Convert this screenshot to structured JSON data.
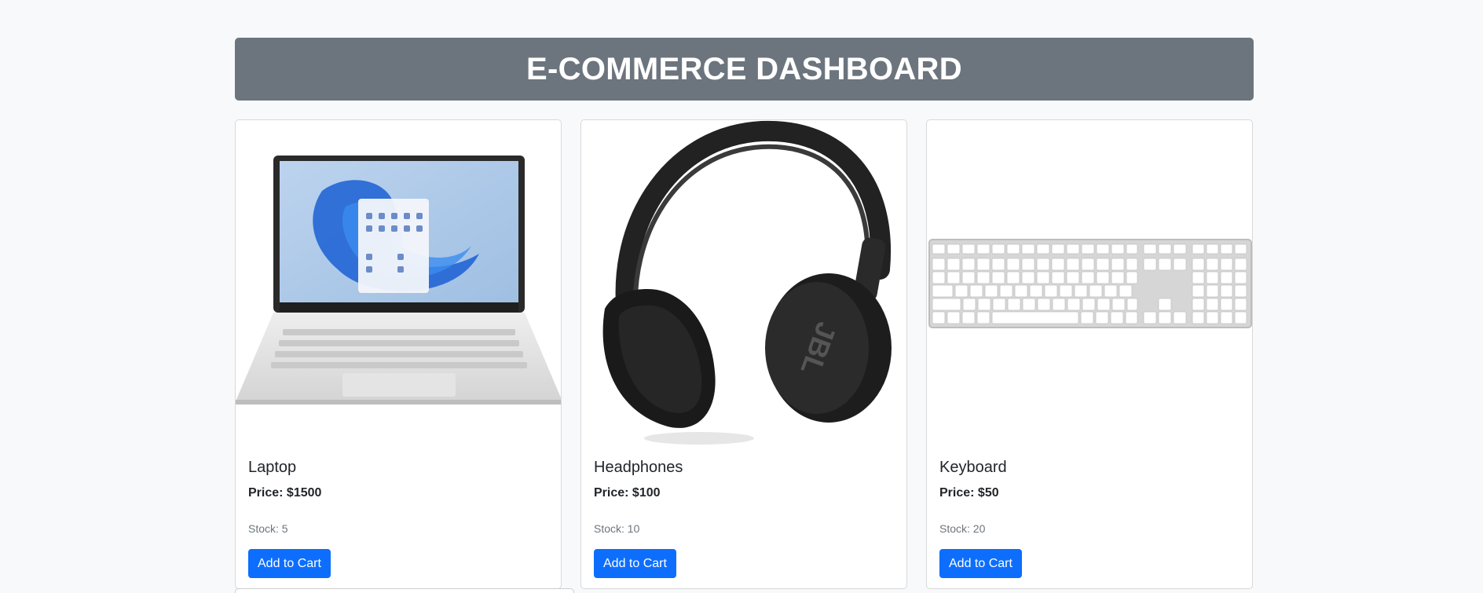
{
  "header": {
    "title": "E-COMMERCE DASHBOARD"
  },
  "products": [
    {
      "name": "Laptop",
      "price": "Price: $1500",
      "stock": "Stock: 5",
      "button": "Add to Cart",
      "image_icon": "laptop-icon"
    },
    {
      "name": "Headphones",
      "price": "Price: $100",
      "stock": "Stock: 10",
      "button": "Add to Cart",
      "image_icon": "headphones-icon"
    },
    {
      "name": "Keyboard",
      "price": "Price: $50",
      "stock": "Stock: 20",
      "button": "Add to Cart",
      "image_icon": "keyboard-icon"
    }
  ],
  "colors": {
    "header_bg": "#6c757d",
    "button_bg": "#0d6efd",
    "page_bg": "#f8f9fa"
  }
}
